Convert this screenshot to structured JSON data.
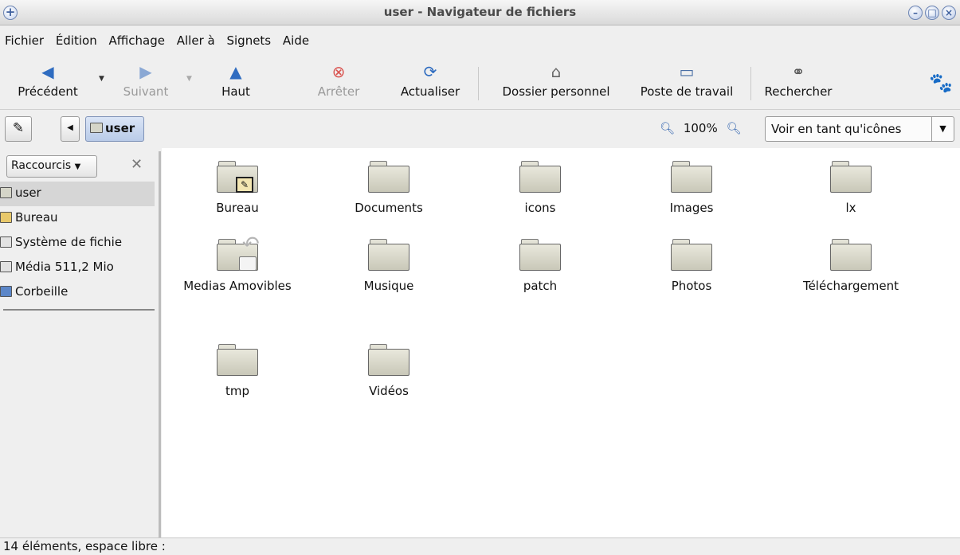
{
  "window": {
    "title": "user - Navigateur de fichiers"
  },
  "menu": [
    "Fichier",
    "Édition",
    "Affichage",
    "Aller à",
    "Signets",
    "Aide"
  ],
  "toolbar": {
    "back": "Précédent",
    "forward": "Suivant",
    "up": "Haut",
    "stop": "Arrêter",
    "reload": "Actualiser",
    "home": "Dossier personnel",
    "computer": "Poste de travail",
    "search": "Rechercher"
  },
  "location": {
    "path_segment": "user",
    "zoom": "100%",
    "view_mode": "Voir en tant qu'icônes"
  },
  "sidebar": {
    "title": "Raccourcis",
    "items": [
      {
        "label": "user",
        "icon": "home-folder-icon"
      },
      {
        "label": "Bureau",
        "icon": "desktop-icon"
      },
      {
        "label": "Système de fichie",
        "icon": "drive-icon"
      },
      {
        "label": "Média 511,2 Mio",
        "icon": "drive-icon"
      },
      {
        "label": "Corbeille",
        "icon": "trash-icon"
      }
    ]
  },
  "files": [
    "Bureau",
    "Documents",
    "icons",
    "Images",
    "lx",
    "Medias Amovibles",
    "Musique",
    "patch",
    "Photos",
    "Téléchargement",
    "tmp",
    "Vidéos"
  ],
  "status": "14 éléments, espace libre :"
}
